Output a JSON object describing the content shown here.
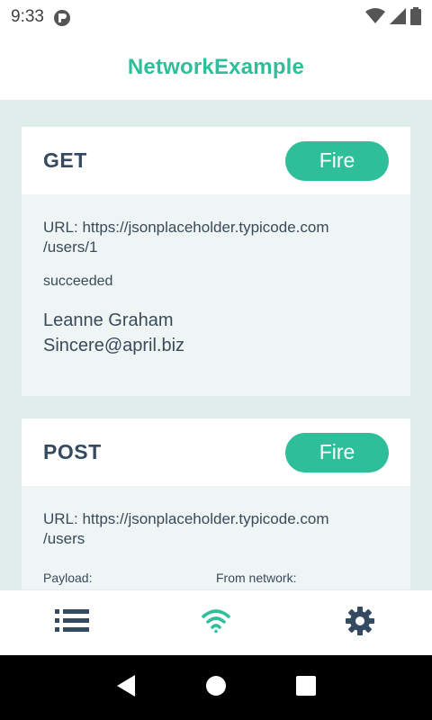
{
  "status_bar": {
    "time": "9:33"
  },
  "app": {
    "title": "NetworkExample"
  },
  "cards": [
    {
      "method": "GET",
      "fire_label": "Fire",
      "url_line1": "URL: https://jsonplaceholder.typicode.com",
      "url_line2": "/users/1",
      "status": "succeeded",
      "result_name": "Leanne Graham",
      "result_email": "Sincere@april.biz"
    },
    {
      "method": "POST",
      "fire_label": "Fire",
      "url_line1": "URL: https://jsonplaceholder.typicode.com",
      "url_line2": "/users",
      "payload_label": "Payload:",
      "payload_value": "{",
      "from_network_label": "From network:",
      "from_network_value": "{"
    }
  ],
  "bottom_nav": {
    "items": [
      {
        "icon": "list-icon",
        "active": false
      },
      {
        "icon": "wifi-icon",
        "active": true
      },
      {
        "icon": "gear-icon",
        "active": false
      }
    ],
    "active_color": "#2ebf9a",
    "inactive_color": "#344a60"
  }
}
